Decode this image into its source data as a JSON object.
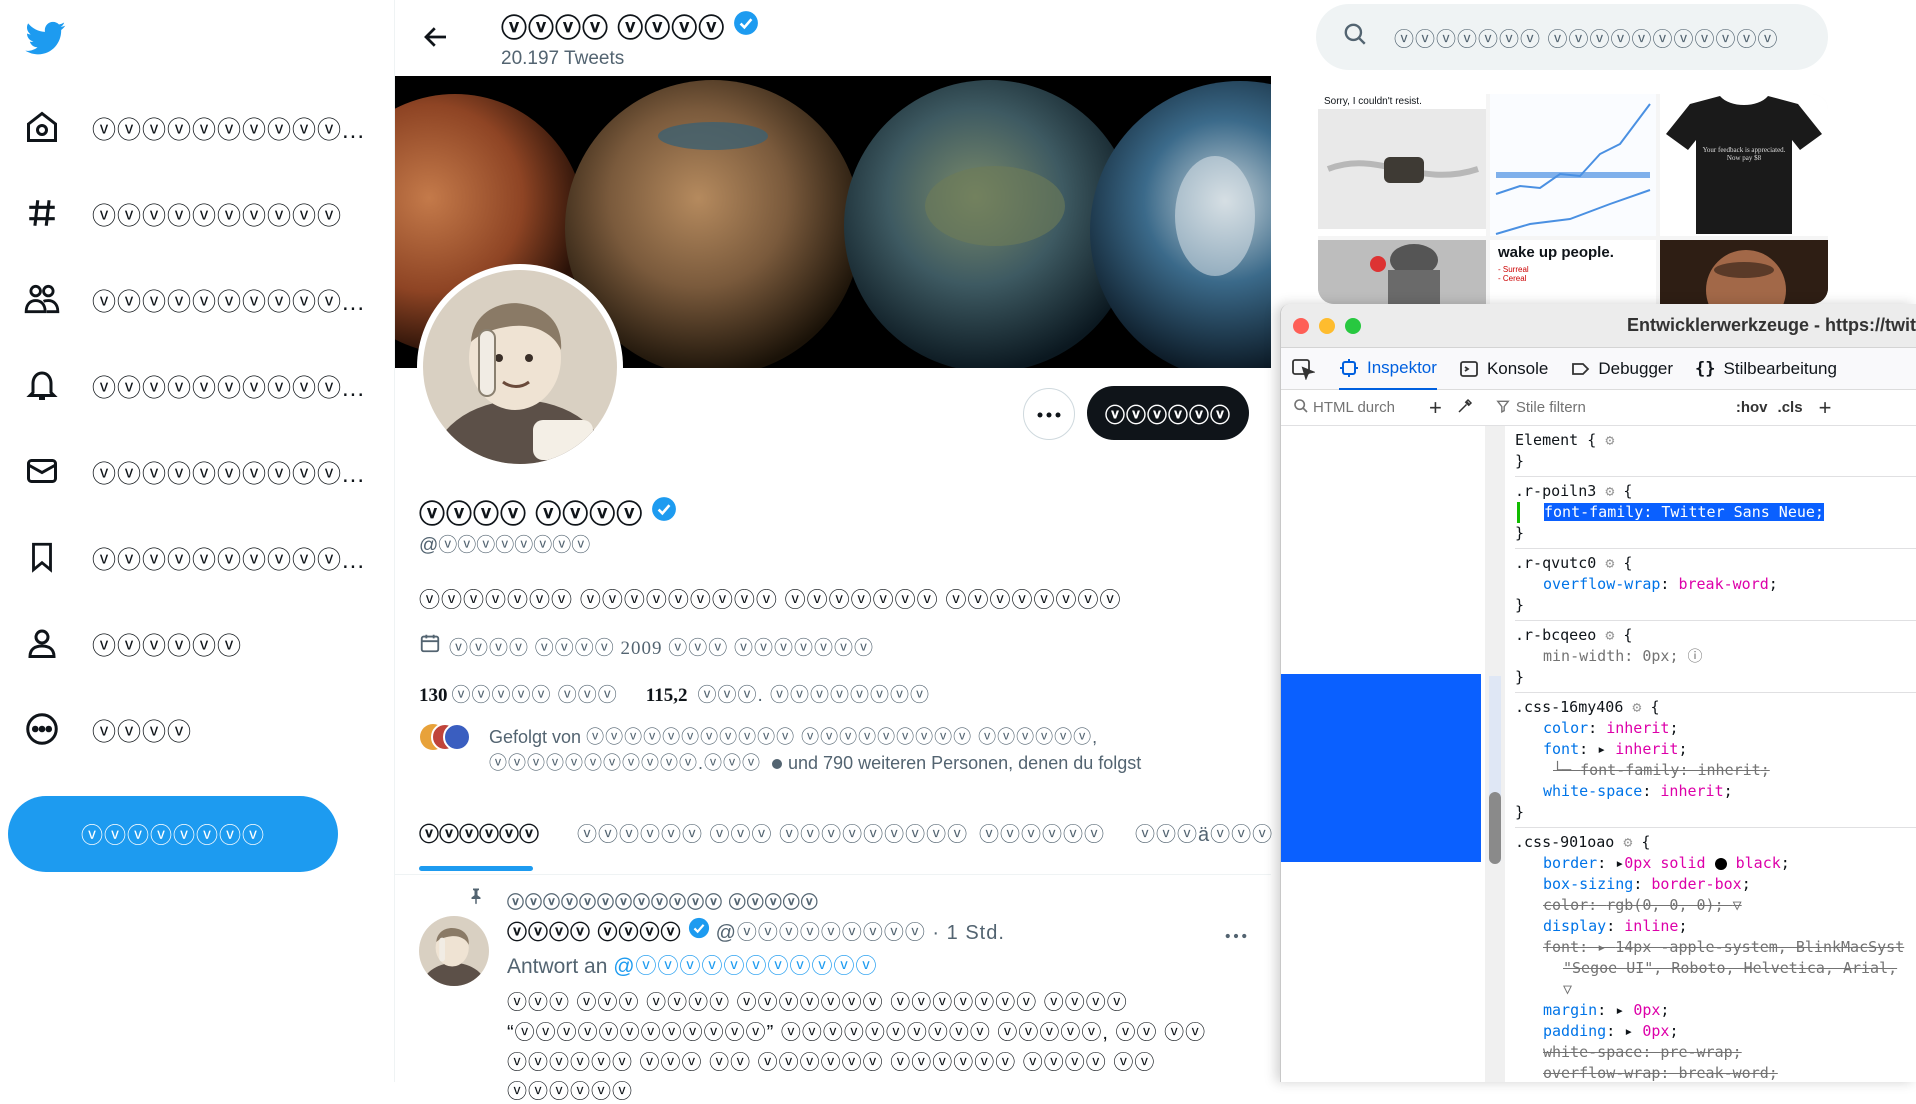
{
  "nav": {
    "items": [
      {
        "name": "home",
        "label": "ⓥⓥⓥⓥⓥⓥⓥⓥⓥⓥ..."
      },
      {
        "name": "explore",
        "label": "ⓥⓥⓥⓥⓥⓥⓥⓥⓥⓥ"
      },
      {
        "name": "communities",
        "label": "ⓥⓥⓥⓥⓥⓥⓥⓥⓥⓥ..."
      },
      {
        "name": "notifications",
        "label": "ⓥⓥⓥⓥⓥⓥⓥⓥⓥⓥ..."
      },
      {
        "name": "messages",
        "label": "ⓥⓥⓥⓥⓥⓥⓥⓥⓥⓥ..."
      },
      {
        "name": "bookmarks",
        "label": "ⓥⓥⓥⓥⓥⓥⓥⓥⓥⓥ..."
      },
      {
        "name": "profile",
        "label": "ⓥⓥⓥⓥⓥⓥ"
      },
      {
        "name": "more",
        "label": "ⓥⓥⓥⓥ"
      }
    ],
    "tweet_button": "ⓥⓥⓥⓥⓥⓥⓥⓥ"
  },
  "header": {
    "name": "ⓥⓥⓥⓥ ⓥⓥⓥⓥ",
    "tweet_count": "20.197 Tweets"
  },
  "profile": {
    "name": "ⓥⓥⓥⓥ ⓥⓥⓥⓥ",
    "handle": "@ⓥⓥⓥⓥⓥⓥⓥⓥ",
    "bio": "ⓥⓥⓥⓥⓥⓥⓥ ⓥⓥⓥⓥⓥⓥⓥⓥⓥ ⓥⓥⓥⓥⓥⓥⓥ ⓥⓥⓥⓥⓥⓥⓥⓥ",
    "joined": "ⓥⓥⓥⓥ ⓥⓥⓥⓥ 2009 ⓥⓥⓥ ⓥⓥⓥⓥⓥⓥⓥ",
    "following_count": "130",
    "following_label": "ⓥⓥⓥⓥⓥ ⓥⓥⓥ",
    "followers_count": "115,2",
    "followers_label": "ⓥⓥⓥ. ⓥⓥⓥⓥⓥⓥⓥⓥ",
    "followed_by_prefix": "Gefolgt von",
    "followed_by_names": "ⓥⓥⓥⓥⓥⓥⓥⓥⓥⓥⓥ ⓥⓥⓥⓥⓥⓥⓥⓥⓥ ⓥⓥⓥⓥⓥⓥ,",
    "followed_by_line2_name": "ⓥⓥⓥⓥⓥⓥⓥⓥⓥⓥⓥ.ⓥⓥⓥ",
    "followed_by_suffix": "und 790 weiteren Personen, denen du folgst",
    "follow_button": "ⓥⓥⓥⓥⓥⓥ"
  },
  "tabs": [
    "ⓥⓥⓥⓥⓥⓥ",
    "ⓥⓥⓥⓥⓥⓥ ⓥⓥⓥ ⓥⓥⓥⓥⓥⓥⓥⓥⓥ",
    "ⓥⓥⓥⓥⓥⓥ",
    "ⓥⓥⓥäⓥⓥⓥ"
  ],
  "tweet": {
    "pinned_label": "ⓥⓥⓥⓥⓥⓥⓥⓥⓥⓥⓥⓥ ⓥⓥⓥⓥⓥ",
    "author": "ⓥⓥⓥⓥ ⓥⓥⓥⓥ",
    "handle_time": "@ⓥⓥⓥⓥⓥⓥⓥⓥⓥ · 1 Std.",
    "reply_prefix": "Antwort an",
    "reply_to": "@ⓥⓥⓥⓥⓥⓥⓥⓥⓥⓥⓥ",
    "line1": "ⓥⓥⓥ ⓥⓥⓥ ⓥⓥⓥⓥ ⓥⓥⓥⓥⓥⓥⓥ ⓥⓥⓥⓥⓥⓥⓥ ⓥⓥⓥⓥ",
    "line2": "“ⓥⓥⓥⓥⓥⓥⓥⓥⓥⓥⓥⓥ” ⓥⓥⓥⓥⓥⓥⓥⓥⓥⓥ ⓥⓥⓥⓥⓥ, ⓥⓥ ⓥⓥ",
    "line3": "ⓥⓥⓥⓥⓥⓥ ⓥⓥⓥ ⓥⓥ ⓥⓥⓥⓥⓥⓥ ⓥⓥⓥⓥⓥⓥ ⓥⓥⓥⓥ ⓥⓥ ⓥⓥⓥⓥⓥⓥ"
  },
  "search": {
    "placeholder": "ⓥⓥⓥⓥⓥⓥⓥ ⓥⓥⓥⓥⓥⓥⓥⓥⓥⓥⓥ"
  },
  "media": {
    "caption1": "Sorry, I couldn't resist.",
    "caption_wake": "wake up people.",
    "shirt_text": "Your feedback is appreciated. Now pay $8",
    "list_items": [
      "- Surreal",
      "- Cereal"
    ]
  },
  "devtools": {
    "title": "Entwicklerwerkzeuge - https://twit",
    "tabs": [
      "Inspektor",
      "Konsole",
      "Debugger",
      "Stilbearbeitung"
    ],
    "html_search_placeholder": "HTML durch",
    "filter_placeholder": "Stile filtern",
    "hov": ":hov",
    "cls": ".cls",
    "rules": {
      "element_sel": "Element {",
      "r1_sel": ".r-poiln3",
      "r1_decl": "font-family: Twitter Sans Neue;",
      "r2_sel": ".r-qvutc0",
      "r2_prop": "overflow-wrap",
      "r2_val": "break-word",
      "r3_sel": ".r-bcqeeo",
      "r3_prop": "min-width",
      "r3_val": "0px",
      "r4_sel": ".css-16my406",
      "r4_p1": "color",
      "r4_v1": "inherit",
      "r4_p2": "font",
      "r4_v2": "inherit",
      "r4_p3": "font-family",
      "r4_v3": "inherit",
      "r4_p4": "white-space",
      "r4_v4": "inherit",
      "r5_sel": ".css-901oao",
      "r5_p1": "border",
      "r5_v1": "0px solid",
      "r5_v1b": "black",
      "r5_p2": "box-sizing",
      "r5_v2": "border-box",
      "r5_p3": "color",
      "r5_v3": "rgb(0, 0, 0)",
      "r5_p4": "display",
      "r5_v4": "inline",
      "r5_p5": "font",
      "r5_v5": "14px -apple-system, BlinkMacSyst",
      "r5_v5b": "\"Segoe UI\", Roboto, Helvetica, Arial,",
      "r5_p6": "margin",
      "r5_v6": "0px",
      "r5_p7": "padding",
      "r5_v7": "0px",
      "r5_p8": "white-space",
      "r5_v8": "pre-wrap",
      "r5_p9": "overflow-wrap",
      "r5_v9": "break-word"
    }
  },
  "colors": {
    "twitter_blue": "#1d9bf0",
    "devtools_accent": "#0060df",
    "selection_blue": "#0a60ff"
  }
}
